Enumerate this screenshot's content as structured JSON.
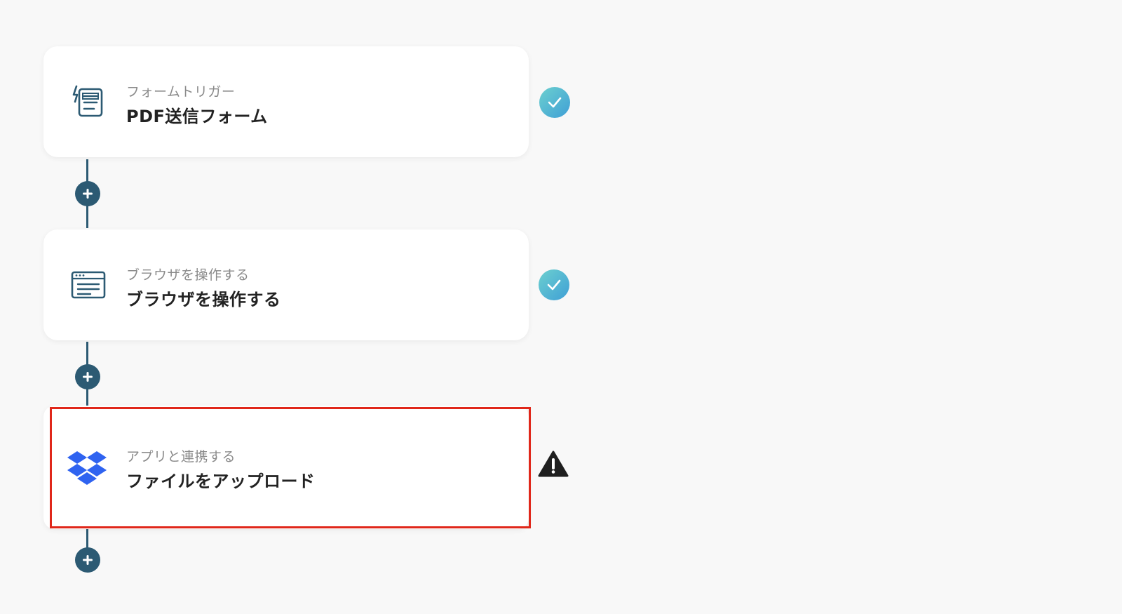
{
  "steps": [
    {
      "subtitle": "フォームトリガー",
      "title": "PDF送信フォーム",
      "icon": "form-trigger-icon",
      "status": "complete"
    },
    {
      "subtitle": "ブラウザを操作する",
      "title": "ブラウザを操作する",
      "icon": "browser-window-icon",
      "status": "complete"
    },
    {
      "subtitle": "アプリと連携する",
      "title": "ファイルをアップロード",
      "icon": "dropbox-icon",
      "status": "warning"
    }
  ],
  "colors": {
    "connector": "#2c5a73",
    "highlight": "#e0271a",
    "check_start": "#6cd0cf",
    "check_end": "#3f9fd6",
    "dropbox": "#2f63f0",
    "warning": "#1f1f1f"
  }
}
